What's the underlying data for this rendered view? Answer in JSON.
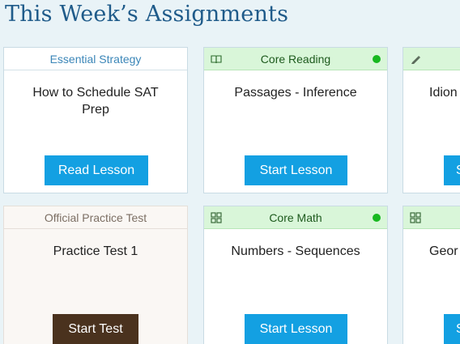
{
  "page": {
    "title": "This Week’s Assignments"
  },
  "row1": [
    {
      "category": "Essential Strategy",
      "title": "How to Schedule SAT Prep",
      "button": "Read Lesson"
    },
    {
      "category": "Core Reading",
      "icon": "book-icon",
      "status_dot": "#18b820",
      "title": "Passages - Inference",
      "button": "Start Lesson"
    },
    {
      "category": "",
      "icon": "pencil-icon",
      "title": "Idion",
      "button": "S"
    }
  ],
  "row2": [
    {
      "category": "Official Practice Test",
      "title": "Practice Test 1",
      "button": "Start Test"
    },
    {
      "category": "Core Math",
      "icon": "grid-icon",
      "status_dot": "#18b820",
      "title": "Numbers - Sequences",
      "button": "Start Lesson"
    },
    {
      "category": "",
      "icon": "grid-icon",
      "title": "Geor",
      "button": "S"
    }
  ],
  "colors": {
    "title": "#1f5b8a",
    "button_blue": "#13a0e2",
    "button_brown": "#4a321e",
    "green_header": "#d9f6d9",
    "status_green": "#18b820"
  }
}
